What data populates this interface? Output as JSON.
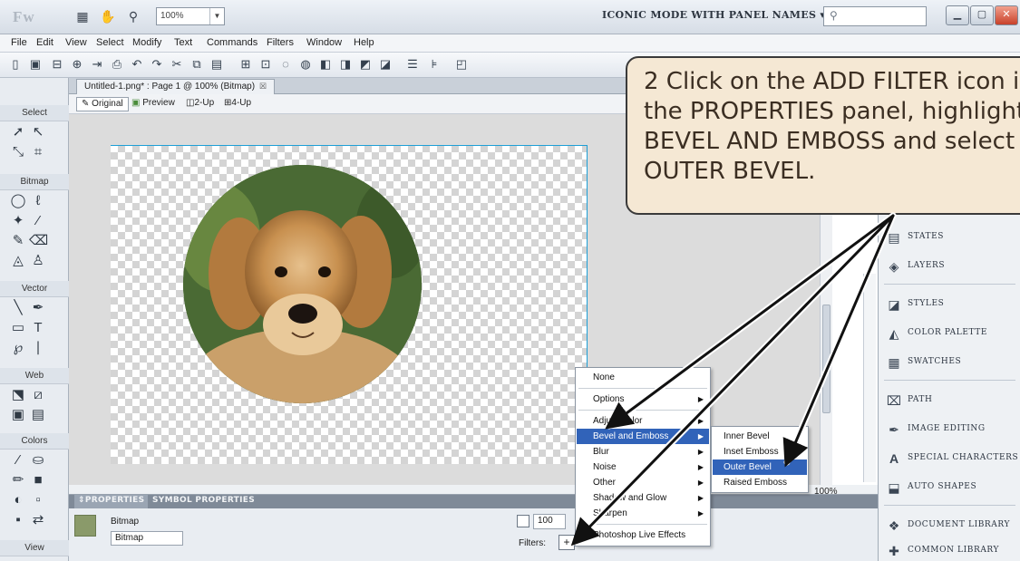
{
  "app": {
    "logo": "Fw",
    "zoom": "100%",
    "workspace_mode": "ICONIC MODE WITH PANEL NAMES",
    "search_icon": "search-icon"
  },
  "menus": [
    "File",
    "Edit",
    "View",
    "Select",
    "Modify",
    "Text",
    "Commands",
    "Filters",
    "Window",
    "Help"
  ],
  "document": {
    "tab_title": "Untitled-1.png* : Page 1 @ 100% (Bitmap)",
    "views": [
      "Original",
      "Preview",
      "2-Up",
      "4-Up"
    ],
    "status_zoom": "100%"
  },
  "tools": {
    "sections": [
      "Select",
      "Bitmap",
      "Vector",
      "Web",
      "Colors",
      "View"
    ]
  },
  "properties": {
    "tabs": [
      "PROPERTIES",
      "SYMBOL PROPERTIES"
    ],
    "object_type": "Bitmap",
    "object_name": "Bitmap",
    "opacity": "100",
    "filters_label": "Filters:"
  },
  "right_panel": [
    {
      "label": "STATES",
      "icon": "states-icon"
    },
    {
      "label": "LAYERS",
      "icon": "layers-icon"
    },
    {
      "label": "STYLES",
      "icon": "styles-icon"
    },
    {
      "label": "COLOR PALETTE",
      "icon": "color-palette-icon"
    },
    {
      "label": "SWATCHES",
      "icon": "swatches-icon"
    },
    {
      "label": "PATH",
      "icon": "path-icon"
    },
    {
      "label": "IMAGE EDITING",
      "icon": "image-editing-icon"
    },
    {
      "label": "SPECIAL CHARACTERS",
      "icon": "special-characters-icon"
    },
    {
      "label": "AUTO SHAPES",
      "icon": "auto-shapes-icon"
    },
    {
      "label": "DOCUMENT LIBRARY",
      "icon": "document-library-icon"
    },
    {
      "label": "COMMON LIBRARY",
      "icon": "common-library-icon"
    }
  ],
  "filter_menu": {
    "items": [
      "None",
      "Options",
      "Adjust Color",
      "Bevel and Emboss",
      "Blur",
      "Noise",
      "Other",
      "Shadow and Glow",
      "Sharpen",
      "Photoshop Live Effects"
    ],
    "submenu": [
      "Inner Bevel",
      "Inset Emboss",
      "Outer Bevel",
      "Raised Emboss"
    ],
    "highlighted": "Bevel and Emboss",
    "selected_sub": "Outer Bevel"
  },
  "callout": {
    "text": "2  Click on the ADD FILTER icon in the PROPERTIES panel, highlight BEVEL AND EMBOSS and select OUTER BEVEL."
  },
  "colors": {
    "highlight": "#3163b9",
    "callout_bg": "#f5e8d4",
    "guide": "#1e9fd6"
  }
}
